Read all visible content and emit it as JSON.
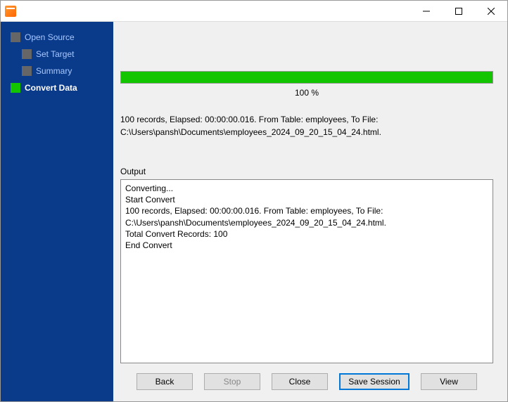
{
  "titlebar": {
    "title": ""
  },
  "sidebar": {
    "steps": [
      {
        "label": "Open Source",
        "active": false,
        "indent": false
      },
      {
        "label": "Set Target",
        "active": false,
        "indent": true
      },
      {
        "label": "Summary",
        "active": false,
        "indent": true
      },
      {
        "label": "Convert Data",
        "active": true,
        "indent": false
      }
    ]
  },
  "progress": {
    "percent": 100,
    "text": "100 %"
  },
  "status_line1": "100 records,    Elapsed: 00:00:00.016.    From Table: employees,    To File:",
  "status_line2": "C:\\Users\\pansh\\Documents\\employees_2024_09_20_15_04_24.html.",
  "output": {
    "label": "Output",
    "lines": [
      "Converting...",
      "Start Convert",
      "100 records,    Elapsed: 00:00:00.016.    From Table: employees,    To File: C:\\Users\\pansh\\Documents\\employees_2024_09_20_15_04_24.html.",
      "Total Convert Records: 100",
      "End Convert"
    ]
  },
  "buttons": {
    "back": "Back",
    "stop": "Stop",
    "close": "Close",
    "save_session": "Save Session",
    "view": "View"
  }
}
